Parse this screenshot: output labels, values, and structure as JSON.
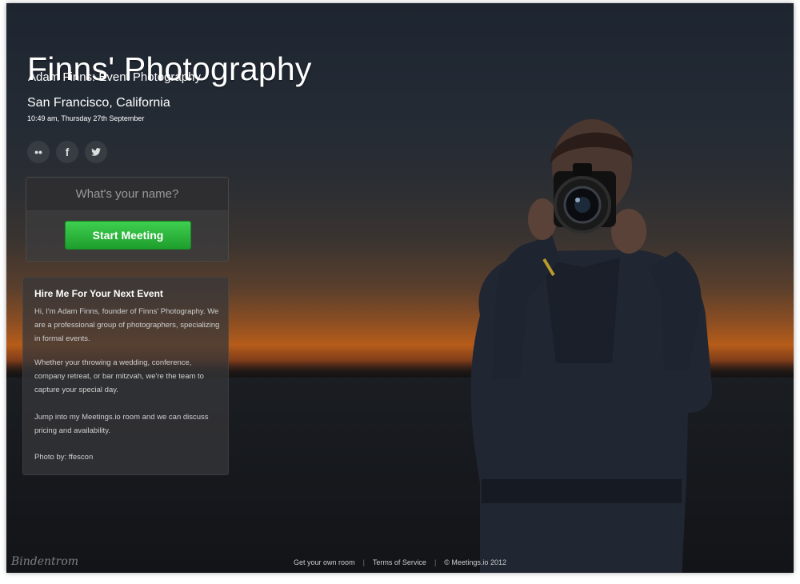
{
  "header": {
    "title": "Finns' Photography",
    "subtitle": "Adam Finns: Event Photography",
    "location": "San Francisco, California",
    "datetime": "10:49 am, Thursday 27th September"
  },
  "social": [
    {
      "icon": "flickr-icon",
      "glyph": "••"
    },
    {
      "icon": "facebook-icon",
      "glyph": "f"
    },
    {
      "icon": "twitter-icon",
      "glyph": "🐦"
    }
  ],
  "meeting": {
    "name_placeholder": "What's your name?",
    "start_label": "Start Meeting",
    "button_color": "#2cb83d"
  },
  "about": {
    "heading": "Hire Me For Your Next Event",
    "para1": "Hi, I'm Adam Finns, founder of Finns' Photography. We are a professional group of photographers, specializing in formal events.",
    "para2": "Whether your throwing a wedding, conference, company retreat, or bar mitzvah, we're the team to capture your special day.",
    "para3": "Jump into my Meetings.io room and we can discuss pricing and availability.",
    "credit": "Photo by: ffescon"
  },
  "footer": {
    "link1": "Get your own room",
    "link2": "Terms of Service",
    "copyright": "© Meetings.io 2012"
  },
  "watermark": "Bindentrom"
}
